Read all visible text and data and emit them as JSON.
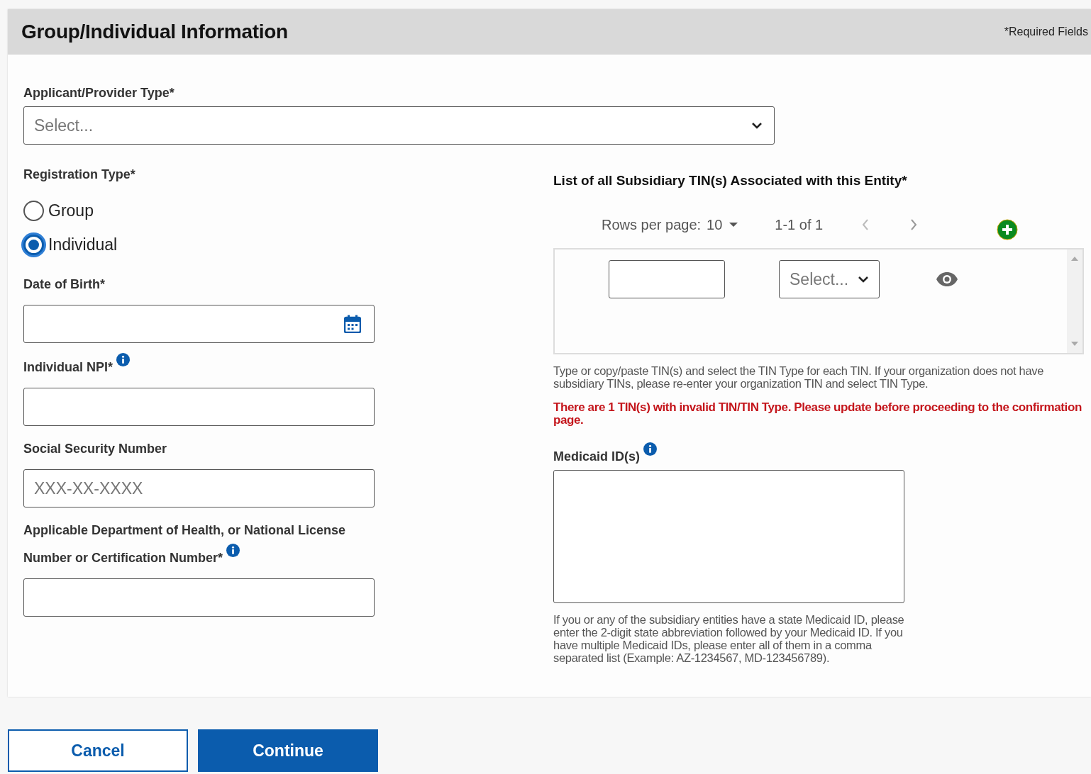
{
  "header": {
    "title": "Group/Individual Information",
    "required_note": "*Required Fields"
  },
  "applicant_type": {
    "label": "Applicant/Provider Type*",
    "placeholder": "Select..."
  },
  "registration_type": {
    "label": "Registration Type*",
    "options": [
      {
        "label": "Group",
        "selected": false
      },
      {
        "label": "Individual",
        "selected": true
      }
    ]
  },
  "fields": [
    {
      "kind": "date",
      "label": "Date of Birth*",
      "info": false
    },
    {
      "kind": "text",
      "label": "Individual NPI*",
      "info": true
    },
    {
      "kind": "text",
      "label": "Social Security Number",
      "placeholder": "XXX-XX-XXXX",
      "info": false
    },
    {
      "kind": "text",
      "label": "Applicable Department of Health, or National License Number or Certification Number*",
      "info": true
    }
  ],
  "tin_list": {
    "title": "List of all Subsidiary TIN(s) Associated with this Entity*",
    "rows_per_page_label": "Rows per page:",
    "rows_per_page": "10",
    "range": "1-1 of 1",
    "rows": [
      {
        "type_placeholder": "Select..."
      }
    ],
    "help": "Type or copy/paste TIN(s) and select the TIN Type for each TIN. If your organization does not have subsidiary TINs, please re-enter your organization TIN and select TIN Type.",
    "error": "There are 1 TIN(s) with invalid TIN/TIN Type. Please update before proceeding to the confirmation page."
  },
  "medicaid": {
    "label": "Medicaid ID(s)",
    "info": true,
    "help": "If you or any of the subsidiary entities have a state Medicaid ID, please enter the 2-digit state abbreviation followed by your Medicaid ID. If you have multiple Medicaid IDs, please enter all of them in a comma separated list (Example: AZ-1234567, MD-123456789)."
  },
  "buttons": [
    {
      "label": "Cancel",
      "kind": "secondary"
    },
    {
      "label": "Continue",
      "kind": "primary"
    }
  ]
}
